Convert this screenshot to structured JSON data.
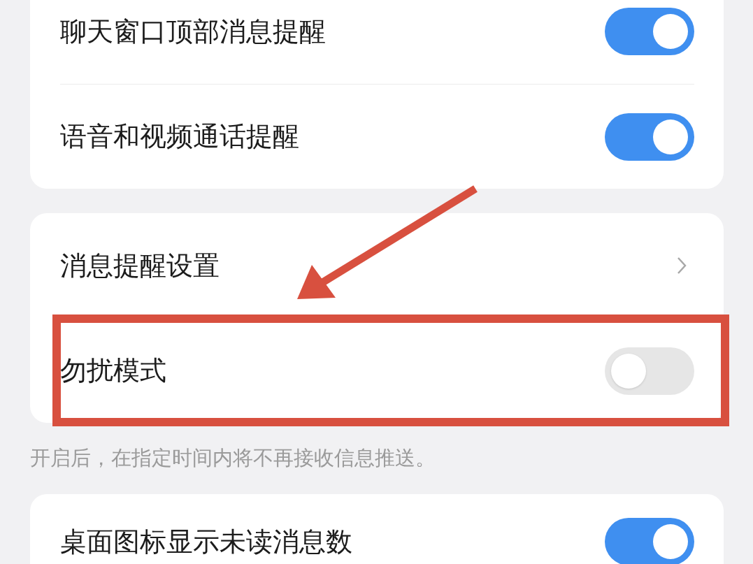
{
  "sections": [
    {
      "rows": [
        {
          "kind": "toggle",
          "label": "聊天窗口顶部消息提醒",
          "on": true
        },
        {
          "kind": "toggle",
          "label": "语音和视频通话提醒",
          "on": true
        }
      ]
    },
    {
      "rows": [
        {
          "kind": "link",
          "label": "消息提醒设置"
        },
        {
          "kind": "toggle",
          "label": "勿扰模式",
          "on": false
        }
      ],
      "caption": "开启后，在指定时间内将不再接收信息推送。"
    },
    {
      "rows": [
        {
          "kind": "toggle",
          "label": "桌面图标显示未读消息数",
          "on": true
        }
      ]
    }
  ],
  "annotation_arrow": {
    "color": "#d8503f"
  },
  "annotation_box": {
    "color": "#d8503f"
  }
}
